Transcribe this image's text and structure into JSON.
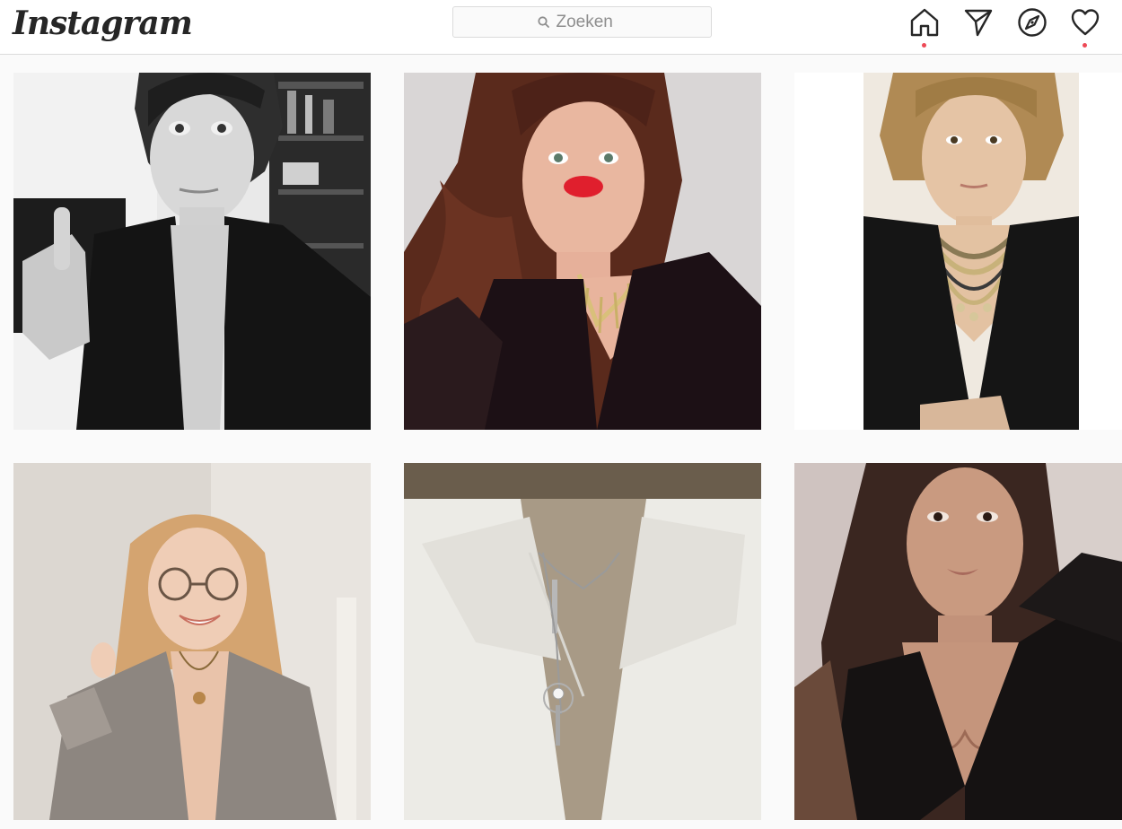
{
  "app": {
    "logo_text": "Instagram"
  },
  "search": {
    "placeholder": "Zoeken",
    "icon": "search-icon"
  },
  "nav": {
    "items": [
      {
        "name": "home",
        "icon": "home-icon",
        "has_notification_dot": true
      },
      {
        "name": "direct",
        "icon": "paper-plane-icon",
        "has_notification_dot": false
      },
      {
        "name": "explore",
        "icon": "compass-icon",
        "has_notification_dot": false
      },
      {
        "name": "activity",
        "icon": "heart-icon",
        "has_notification_dot": true
      }
    ],
    "dot_color": "#ed4956"
  },
  "feed": {
    "posts": [
      {
        "id": "post-1",
        "subject": "woman-in-black-blazer-bw"
      },
      {
        "id": "post-2",
        "subject": "woman-with-curly-hair-red-lips"
      },
      {
        "id": "post-3",
        "subject": "woman-with-short-hair-necklace"
      },
      {
        "id": "post-4",
        "subject": "woman-with-glasses-grey-blazer"
      },
      {
        "id": "post-5",
        "subject": "white-blazer-pendant-necklace"
      },
      {
        "id": "post-6",
        "subject": "woman-with-dark-hair-black-top"
      }
    ]
  },
  "colors": {
    "border": "#dbdbdb",
    "text": "#262626",
    "muted": "#8e8e8e",
    "background": "#fafafa"
  }
}
